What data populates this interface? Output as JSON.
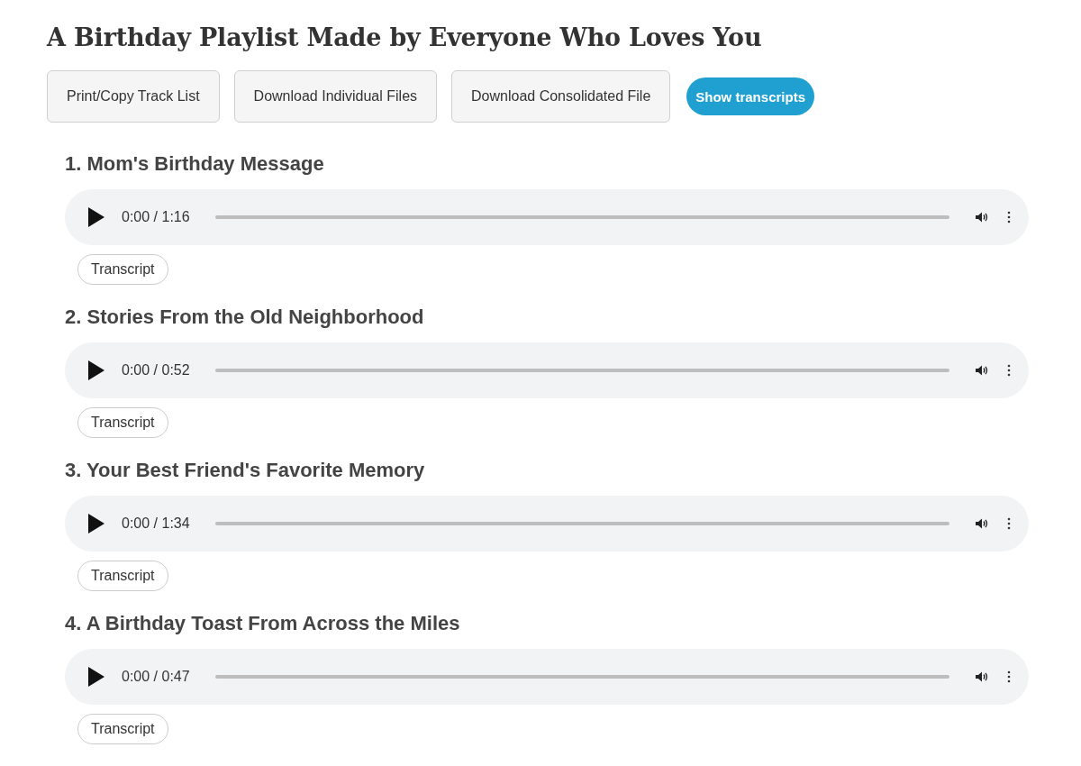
{
  "title": "A Birthday Playlist Made by Everyone Who Loves You",
  "actions": [
    {
      "label": "Print/Copy Track List",
      "kind": "secondary"
    },
    {
      "label": "Download Individual Files",
      "kind": "secondary"
    },
    {
      "label": "Download Consolidated File",
      "kind": "secondary"
    },
    {
      "label": "Show transcripts",
      "kind": "primary"
    }
  ],
  "tracks": [
    {
      "title": "1. Mom's Birthday Message",
      "time": "0:00 / 1:16",
      "transcript_button": "Transcript"
    },
    {
      "title": "2. Stories From the Old Neighborhood",
      "time": "0:00 / 0:52",
      "transcript_button": "Transcript"
    },
    {
      "title": "3. Your Best Friend's Favorite Memory",
      "time": "0:00 / 1:34",
      "transcript_button": "Transcript"
    },
    {
      "title": "4. A Birthday Toast From Across the Miles",
      "time": "0:00 / 0:47",
      "transcript_button": "Transcript"
    }
  ]
}
